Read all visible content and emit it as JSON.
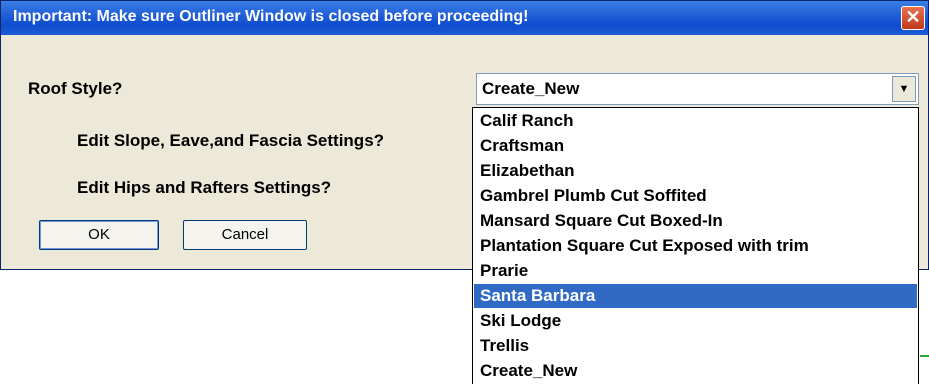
{
  "window": {
    "title": "Important:  Make sure Outliner Window is closed before proceeding!",
    "close_glyph": "✕"
  },
  "form": {
    "roof_style_label": "Roof Style?",
    "slope_label": "Edit  Slope, Eave,and Fascia Settings?",
    "hips_label": "Edit  Hips and Rafters Settings?",
    "ok_label": "OK",
    "cancel_label": "Cancel"
  },
  "combo": {
    "selected_value": "Create_New",
    "arrow_glyph": "▼",
    "options": [
      "Calif Ranch",
      "Craftsman",
      "Elizabethan",
      "Gambrel  Plumb Cut Soffited",
      "Mansard  Square Cut Boxed-In",
      "Plantation Square Cut Exposed with trim",
      "Prarie",
      "Santa Barbara",
      "Ski Lodge",
      "Trellis",
      "Create_New"
    ],
    "highlighted_option": "Santa Barbara"
  },
  "colors": {
    "titlebar": "#0d4ecf",
    "dialog_bg": "#ece9d8",
    "highlight": "#316ac5"
  }
}
